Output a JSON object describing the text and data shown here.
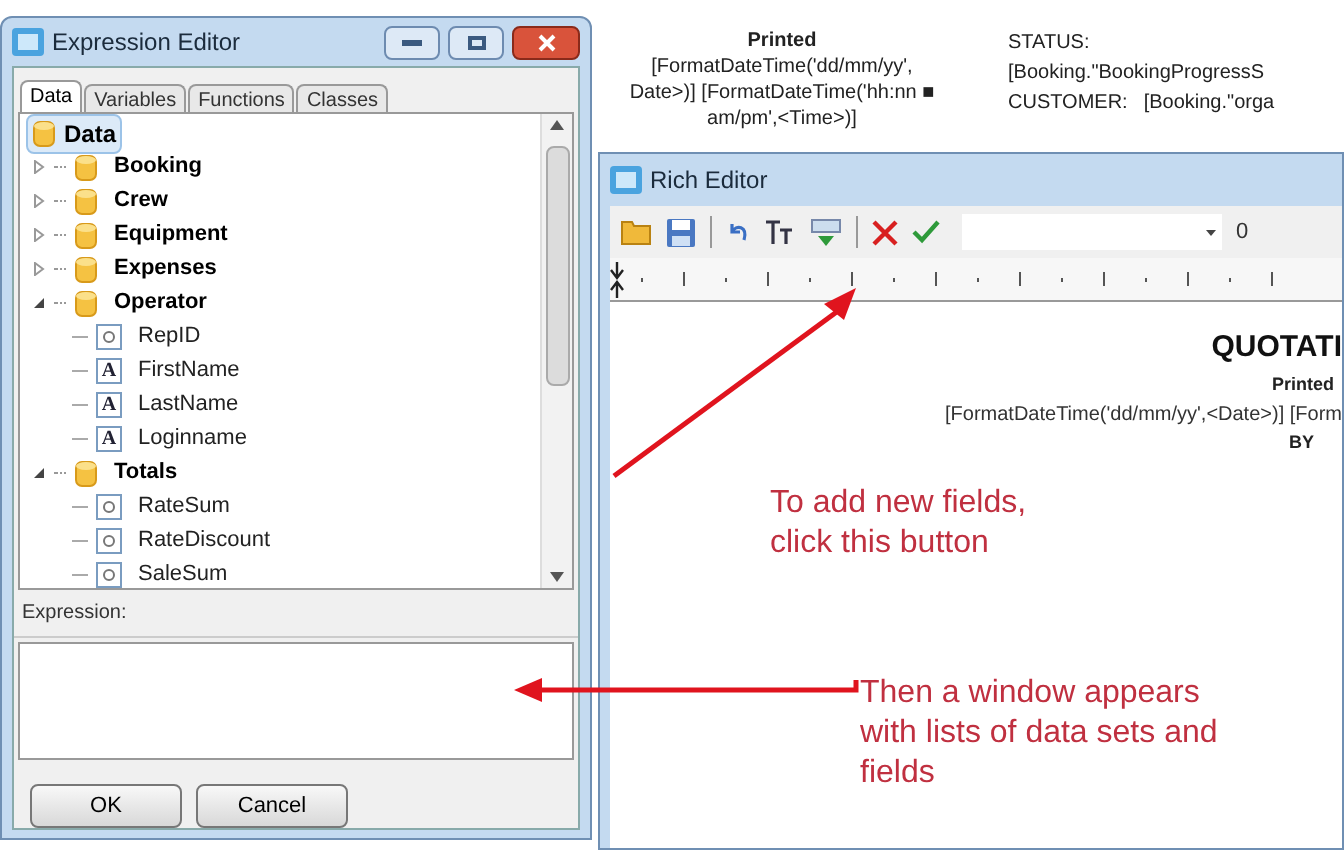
{
  "expression_editor": {
    "title": "Expression Editor",
    "tabs": [
      {
        "label": "Data",
        "selected": true
      },
      {
        "label": "Variables",
        "selected": false
      },
      {
        "label": "Functions",
        "selected": false
      },
      {
        "label": "Classes",
        "selected": false
      }
    ],
    "tree": {
      "label": "Data",
      "selected": true,
      "children": [
        {
          "label": "Booking",
          "expanded": false
        },
        {
          "label": "Crew",
          "expanded": false
        },
        {
          "label": "Equipment",
          "expanded": false
        },
        {
          "label": "Expenses",
          "expanded": false
        },
        {
          "label": "Operator",
          "expanded": true,
          "children": [
            {
              "label": "RepID",
              "kind": "number"
            },
            {
              "label": "FirstName",
              "kind": "text",
              "icon": "A"
            },
            {
              "label": "LastName",
              "kind": "text",
              "icon": "A"
            },
            {
              "label": "Loginname",
              "kind": "text",
              "icon": "A"
            }
          ]
        },
        {
          "label": "Totals",
          "expanded": true,
          "children": [
            {
              "label": "RateSum",
              "kind": "number"
            },
            {
              "label": "RateDiscount",
              "kind": "number"
            },
            {
              "label": "SaleSum",
              "kind": "number"
            }
          ]
        }
      ]
    },
    "expression_label": "Expression:",
    "buttons": [
      "OK",
      "Cancel"
    ]
  },
  "background_document": {
    "left_lines": [
      "Printed",
      "[FormatDateTime('dd/mm/yy',",
      "Date>)] [FormatDateTime('hh:nn ■",
      "am/pm',<Time>)]"
    ],
    "right_lines": [
      [
        "STATUS:"
      ],
      [
        "[Booking.\"BookingProgressS"
      ],
      [
        "CUSTOMER:",
        "[Booking.\"orga"
      ]
    ]
  },
  "rich_editor": {
    "title": "Rich Editor",
    "font_size": "0",
    "document": {
      "heading": "QUOTATI",
      "printed": "Printed",
      "formula": "[FormatDateTime('dd/mm/yy',<Date>)] [Form",
      "by": "BY"
    }
  },
  "annotations": [
    {
      "text": "To add new fields,\nclick this button"
    },
    {
      "text": "Then a window appears\nwith lists of data sets and\nfields"
    }
  ]
}
